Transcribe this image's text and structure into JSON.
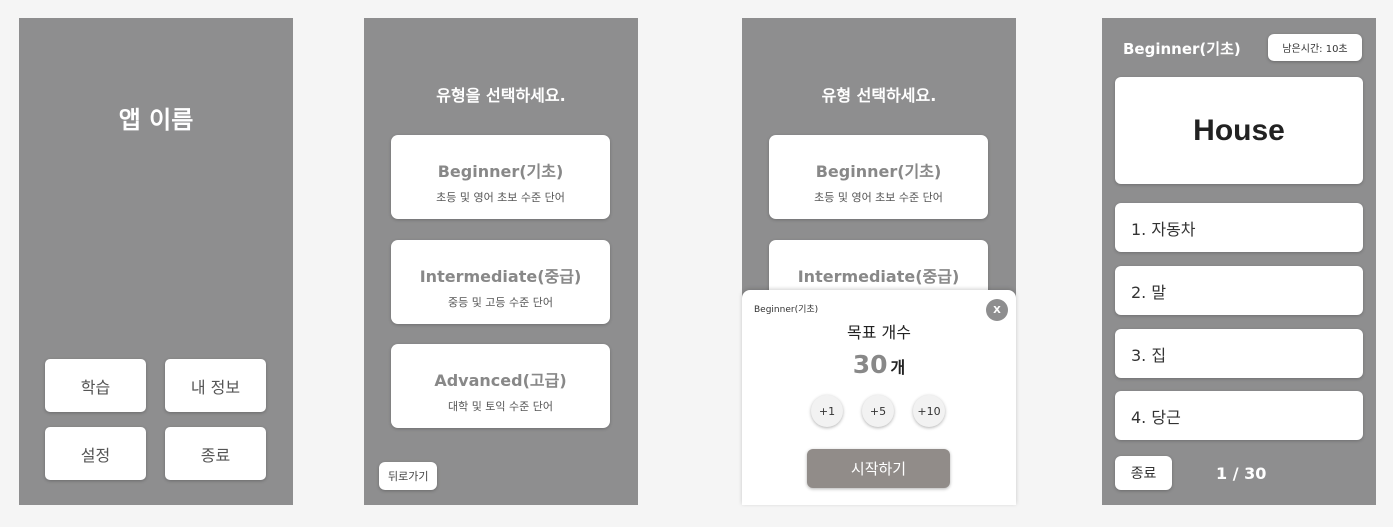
{
  "home": {
    "app_name": "앱 이름",
    "buttons": [
      "학습",
      "내 정보",
      "설정",
      "종료"
    ]
  },
  "select": {
    "heading": "유형을 선택하세요.",
    "levels": [
      {
        "title": "Beginner(기초)",
        "desc": "초등 및 영어 초보 수준 단어"
      },
      {
        "title": "Intermediate(중급)",
        "desc": "중등 및 고등 수준 단어"
      },
      {
        "title": "Advanced(고급)",
        "desc": "대학 및 토익 수준 단어"
      }
    ],
    "back_label": "뒤로가기"
  },
  "goal": {
    "heading": "유형 선택하세요.",
    "levels": [
      {
        "title": "Beginner(기초)",
        "desc": "초등 및 영어 초보 수준 단어"
      },
      {
        "title": "Intermediate(중급)"
      }
    ],
    "modal": {
      "level_label": "Beginner(기초)",
      "close_label": "X",
      "title": "목표 개수",
      "count": "30",
      "unit": "개",
      "increments": [
        "+1",
        "+5",
        "+10"
      ],
      "start_label": "시작하기"
    }
  },
  "quiz": {
    "level": "Beginner(기초)",
    "timer": "남은시간: 10초",
    "word": "House",
    "options": [
      "1. 자동차",
      "2. 말",
      "3. 집",
      "4. 당근"
    ],
    "quit_label": "종료",
    "progress": "1 / 30"
  }
}
